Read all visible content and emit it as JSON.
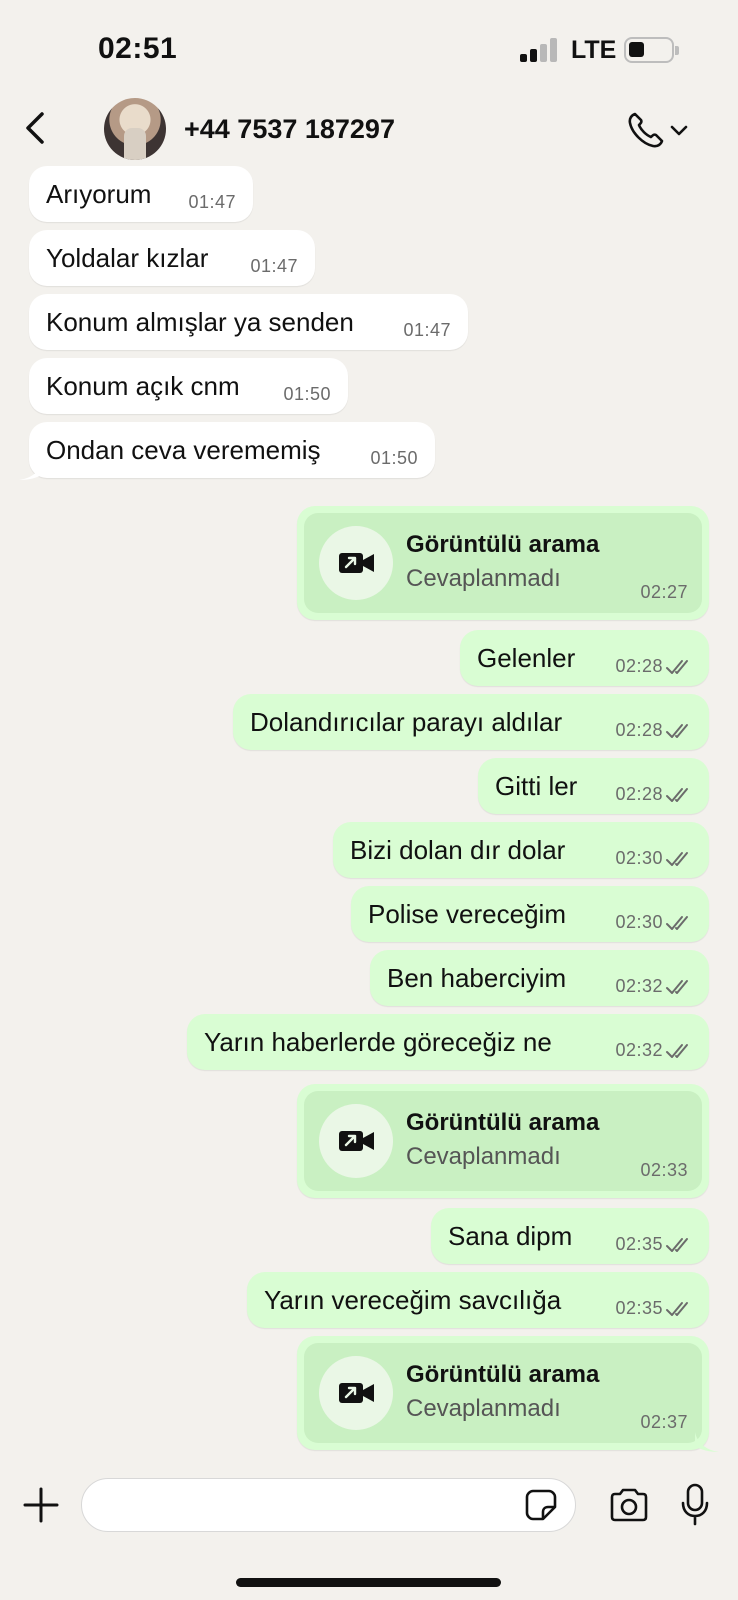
{
  "status_bar": {
    "time": "02:51",
    "network": "LTE",
    "signal_bars": 2,
    "battery_level": 0.3
  },
  "header": {
    "contact_name": "+44 7537 187297"
  },
  "icons": {
    "back": "chevron-left-icon",
    "call": "phone-icon",
    "video_call": "video-camera-icon",
    "ticks": "double-check-icon",
    "plus": "plus-icon",
    "sticker": "sticker-icon",
    "camera": "camera-icon",
    "mic": "microphone-icon"
  },
  "colors": {
    "background": "#f3f1ed",
    "incoming": "#ffffff",
    "outgoing": "#d9fdd3",
    "call_inner": "#c9f0c2"
  },
  "messages": [
    {
      "type": "in",
      "text": "Arıyorum",
      "time": "01:47"
    },
    {
      "type": "in",
      "text": "Yoldalar kızlar",
      "time": "01:47"
    },
    {
      "type": "in",
      "text": "Konum almışlar ya senden",
      "time": "01:47"
    },
    {
      "type": "in",
      "text": "Konum açık cnm",
      "time": "01:50"
    },
    {
      "type": "in",
      "text": "Ondan ceva verememiş",
      "time": "01:50"
    },
    {
      "type": "call",
      "title": "Görüntülü arama",
      "subtitle": "Cevaplanmadı",
      "time": "02:27"
    },
    {
      "type": "out",
      "text": "Gelenler",
      "time": "02:28"
    },
    {
      "type": "out",
      "text": "Dolandırıcılar parayı aldılar",
      "time": "02:28"
    },
    {
      "type": "out",
      "text": "Gitti ler",
      "time": "02:28"
    },
    {
      "type": "out",
      "text": "Bizi dolan dır dolar",
      "time": "02:30"
    },
    {
      "type": "out",
      "text": "Polise vereceğim",
      "time": "02:30"
    },
    {
      "type": "out",
      "text": "Ben haberciyim",
      "time": "02:32"
    },
    {
      "type": "out",
      "text": "Yarın haberlerde göreceğiz ne",
      "time": "02:32"
    },
    {
      "type": "call",
      "title": "Görüntülü arama",
      "subtitle": "Cevaplanmadı",
      "time": "02:33"
    },
    {
      "type": "out",
      "text": "Sana dipm",
      "time": "02:35"
    },
    {
      "type": "out",
      "text": "Yarın vereceğim savcılığa",
      "time": "02:35"
    },
    {
      "type": "call",
      "title": "Görüntülü arama",
      "subtitle": "Cevaplanmadı",
      "time": "02:37"
    }
  ],
  "composer": {
    "placeholder": ""
  }
}
